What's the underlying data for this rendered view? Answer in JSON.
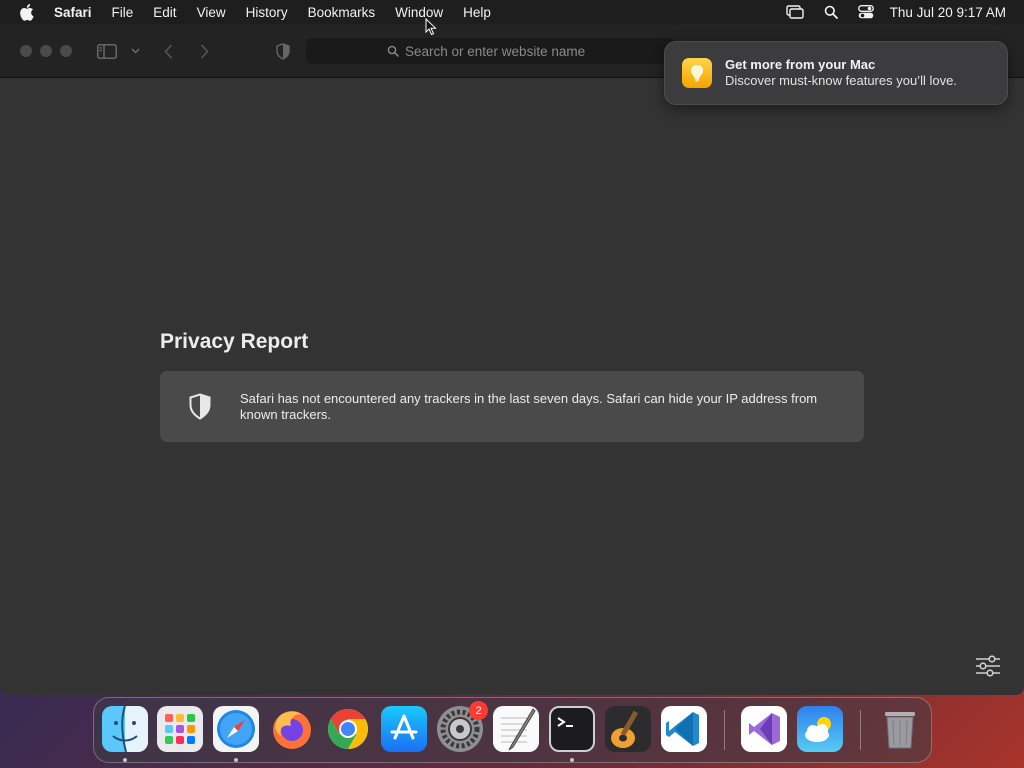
{
  "menubar": {
    "app_name": "Safari",
    "items": [
      "File",
      "Edit",
      "View",
      "History",
      "Bookmarks",
      "Window",
      "Help"
    ],
    "clock": "Thu Jul 20  9:17 AM"
  },
  "toolbar": {
    "search_placeholder": "Search or enter website name"
  },
  "notification": {
    "title": "Get more from your Mac",
    "body": "Discover must-know features you’ll love."
  },
  "privacy_report": {
    "title": "Privacy Report",
    "message": "Safari has not encountered any trackers in the last seven days. Safari can hide your IP address from known trackers."
  },
  "dock": {
    "apps": [
      "finder-icon",
      "launchpad-icon",
      "safari-icon",
      "firefox-icon",
      "chrome-icon",
      "app-store-icon",
      "system-settings-icon",
      "textedit-icon",
      "terminal-icon",
      "garageband-icon",
      "vscode-icon",
      "visual-studio-icon",
      "weather-icon",
      "trash-icon"
    ],
    "settings_badge": "2"
  },
  "colors": {
    "window_bg": "#333334",
    "toolbar_bg": "#232323",
    "card_bg": "#4a4a4b",
    "badge": "#ff3b30"
  }
}
